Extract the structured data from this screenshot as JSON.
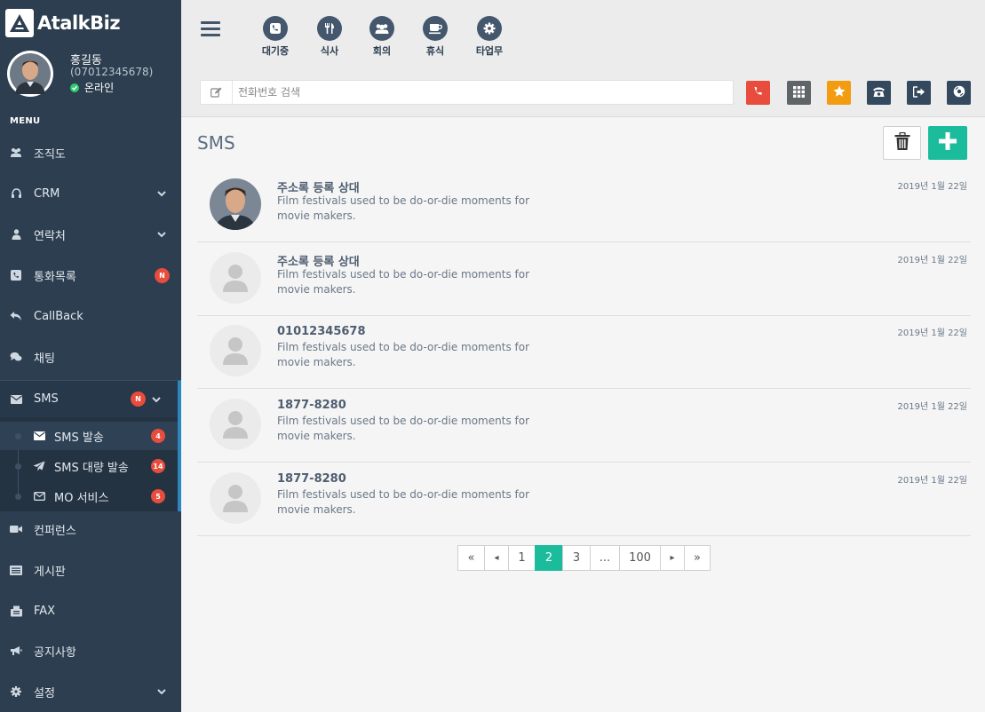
{
  "brand": {
    "name": "AtalkBiz"
  },
  "profile": {
    "name": "홍길동",
    "phone": "(07012345678)",
    "status": "온라인"
  },
  "sidebar": {
    "menu_title": "MENU",
    "items": [
      {
        "label": "조직도",
        "icon": "users-icon"
      },
      {
        "label": "CRM",
        "icon": "headset-icon"
      },
      {
        "label": "연락처",
        "icon": "user-icon"
      },
      {
        "label": "통화목록",
        "icon": "phone-square-icon",
        "badge": "N"
      },
      {
        "label": "CallBack",
        "icon": "reply-icon"
      },
      {
        "label": "채팅",
        "icon": "chat-icon"
      },
      {
        "label": "SMS",
        "icon": "envelope-icon",
        "badge": "N"
      },
      {
        "label": "컨퍼런스",
        "icon": "video-icon"
      },
      {
        "label": "게시판",
        "icon": "list-icon"
      },
      {
        "label": "FAX",
        "icon": "fax-icon"
      },
      {
        "label": "공지사항",
        "icon": "bullhorn-icon"
      },
      {
        "label": "설정",
        "icon": "gear-icon"
      }
    ],
    "sms_sub": [
      {
        "label": "SMS 발송",
        "badge": "4",
        "icon": "envelope-icon"
      },
      {
        "label": "SMS 대량 발송",
        "badge": "14",
        "icon": "paper-plane-icon"
      },
      {
        "label": "MO 서비스",
        "badge": "5",
        "icon": "envelope-outline-icon"
      }
    ]
  },
  "topbar": {
    "status_buttons": [
      {
        "label": "대기중",
        "icon": "phone-icon"
      },
      {
        "label": "식사",
        "icon": "utensils-icon"
      },
      {
        "label": "회의",
        "icon": "users-icon"
      },
      {
        "label": "휴식",
        "icon": "coffee-icon"
      },
      {
        "label": "타업무",
        "icon": "gear-icon"
      }
    ],
    "search": {
      "placeholder": "전화번호 검색"
    },
    "tools": [
      {
        "name": "call-button",
        "color": "#e74c3c"
      },
      {
        "name": "keypad-button",
        "color": "#5f6467"
      },
      {
        "name": "favorite-button",
        "color": "#f39c12"
      },
      {
        "name": "desk-phone-button",
        "color": "#34495e"
      },
      {
        "name": "transfer-button",
        "color": "#34495e"
      },
      {
        "name": "voicemail-button",
        "color": "#34495e"
      }
    ]
  },
  "main": {
    "title": "SMS",
    "messages": [
      {
        "title": "주소록 등록 상대",
        "body": "Film festivals used to be do-or-die moments for movie makers.",
        "date": "2019년 1월 22일",
        "photo": true
      },
      {
        "title": "주소록 등록 상대",
        "body": "Film festivals used to be do-or-die moments for movie makers.",
        "date": "2019년 1월 22일",
        "photo": false
      },
      {
        "title": "01012345678",
        "body": "Film festivals used to be do-or-die moments for movie makers.",
        "date": "2019년 1월 22일",
        "photo": false
      },
      {
        "title": "1877-8280",
        "body": "Film festivals used to be do-or-die moments for movie makers.",
        "date": "2019년 1월 22일",
        "photo": false
      },
      {
        "title": "1877-8280",
        "body": "Film festivals used to be do-or-die moments for movie makers.",
        "date": "2019년 1월 22일",
        "photo": false
      }
    ],
    "pagination": {
      "first": "«",
      "prev": "◂",
      "pages": [
        "1",
        "2",
        "3",
        "...",
        "100"
      ],
      "active": "2",
      "next": "▸",
      "last": "»"
    }
  },
  "colors": {
    "sidebar": "#2d3e50",
    "accent": "#1abc9c",
    "badge": "#e74c3c",
    "active_border": "#2e86c1"
  }
}
